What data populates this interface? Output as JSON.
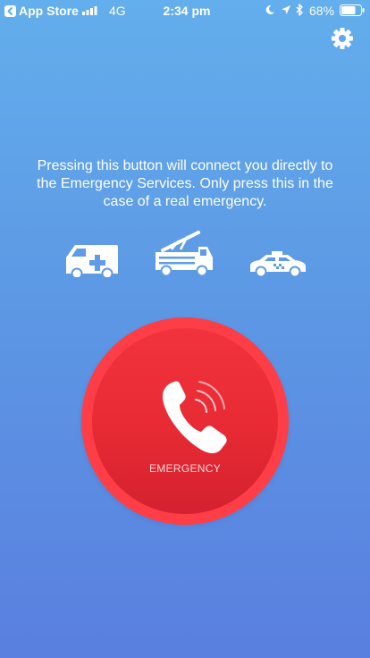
{
  "status_bar": {
    "back_label": "App Store",
    "network": "4G",
    "time": "2:34 pm",
    "battery_percent": "68%"
  },
  "header": {
    "settings_icon": "gear-icon"
  },
  "main": {
    "message": "Pressing this button will connect you directly to the Emergency Services. Only press this in the case of a real emergency.",
    "vehicles": [
      "ambulance-icon",
      "fire-truck-icon",
      "taxi-icon"
    ],
    "emergency_button": {
      "label": "EMERGENCY",
      "icon": "phone-call-icon"
    }
  },
  "colors": {
    "background_top": "#63aeec",
    "background_bottom": "#5a7fdf",
    "button_ring": "#fe3e46",
    "button_core": "#e72a33"
  }
}
